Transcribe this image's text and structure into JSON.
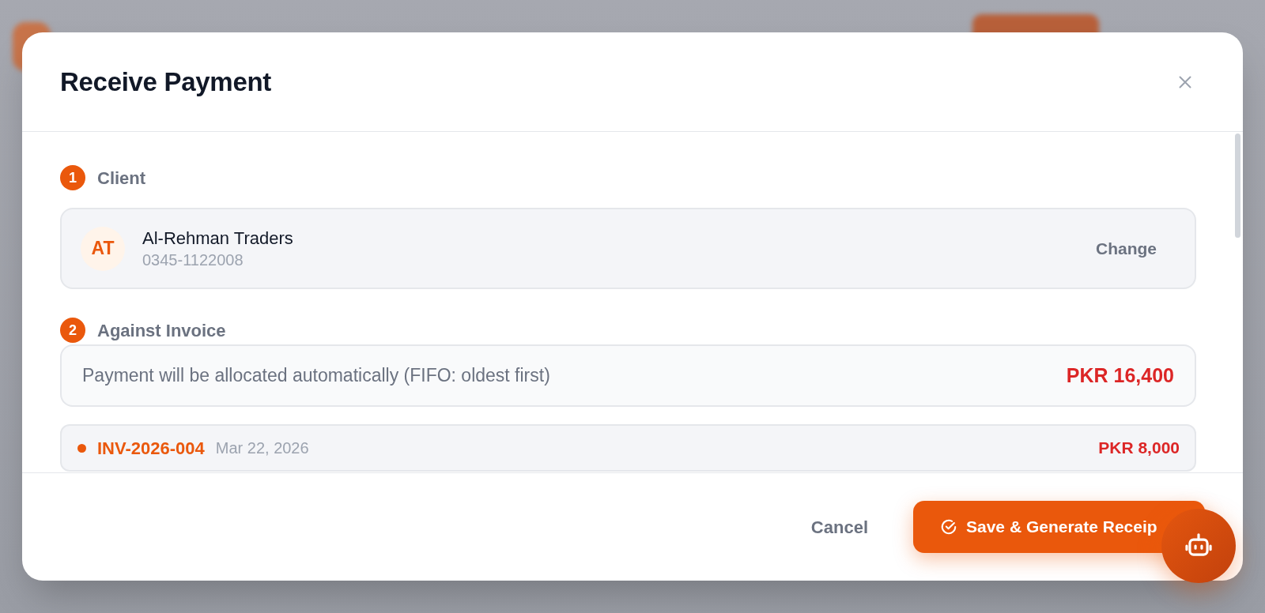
{
  "dialog": {
    "title": "Receive Payment"
  },
  "client_section": {
    "step": "1",
    "title": "Client",
    "client": {
      "initials": "AT",
      "name": "Al-Rehman Traders",
      "phone": "0345-1122008",
      "action": "Change"
    }
  },
  "invoice_section": {
    "step": "2",
    "title": "Against Invoice",
    "allocation": {
      "note": "Payment will be allocated automatically (FIFO: oldest first)",
      "total": "PKR 16,400"
    },
    "invoices": [
      {
        "number": "INV-2026-004",
        "date": "Mar 22, 2026",
        "amount": "PKR 8,000"
      }
    ]
  },
  "footer": {
    "buttons": [
      {
        "kind": "secondary",
        "label": "Cancel"
      },
      {
        "kind": "primary",
        "label": "Save & Generate Receip"
      }
    ]
  }
}
